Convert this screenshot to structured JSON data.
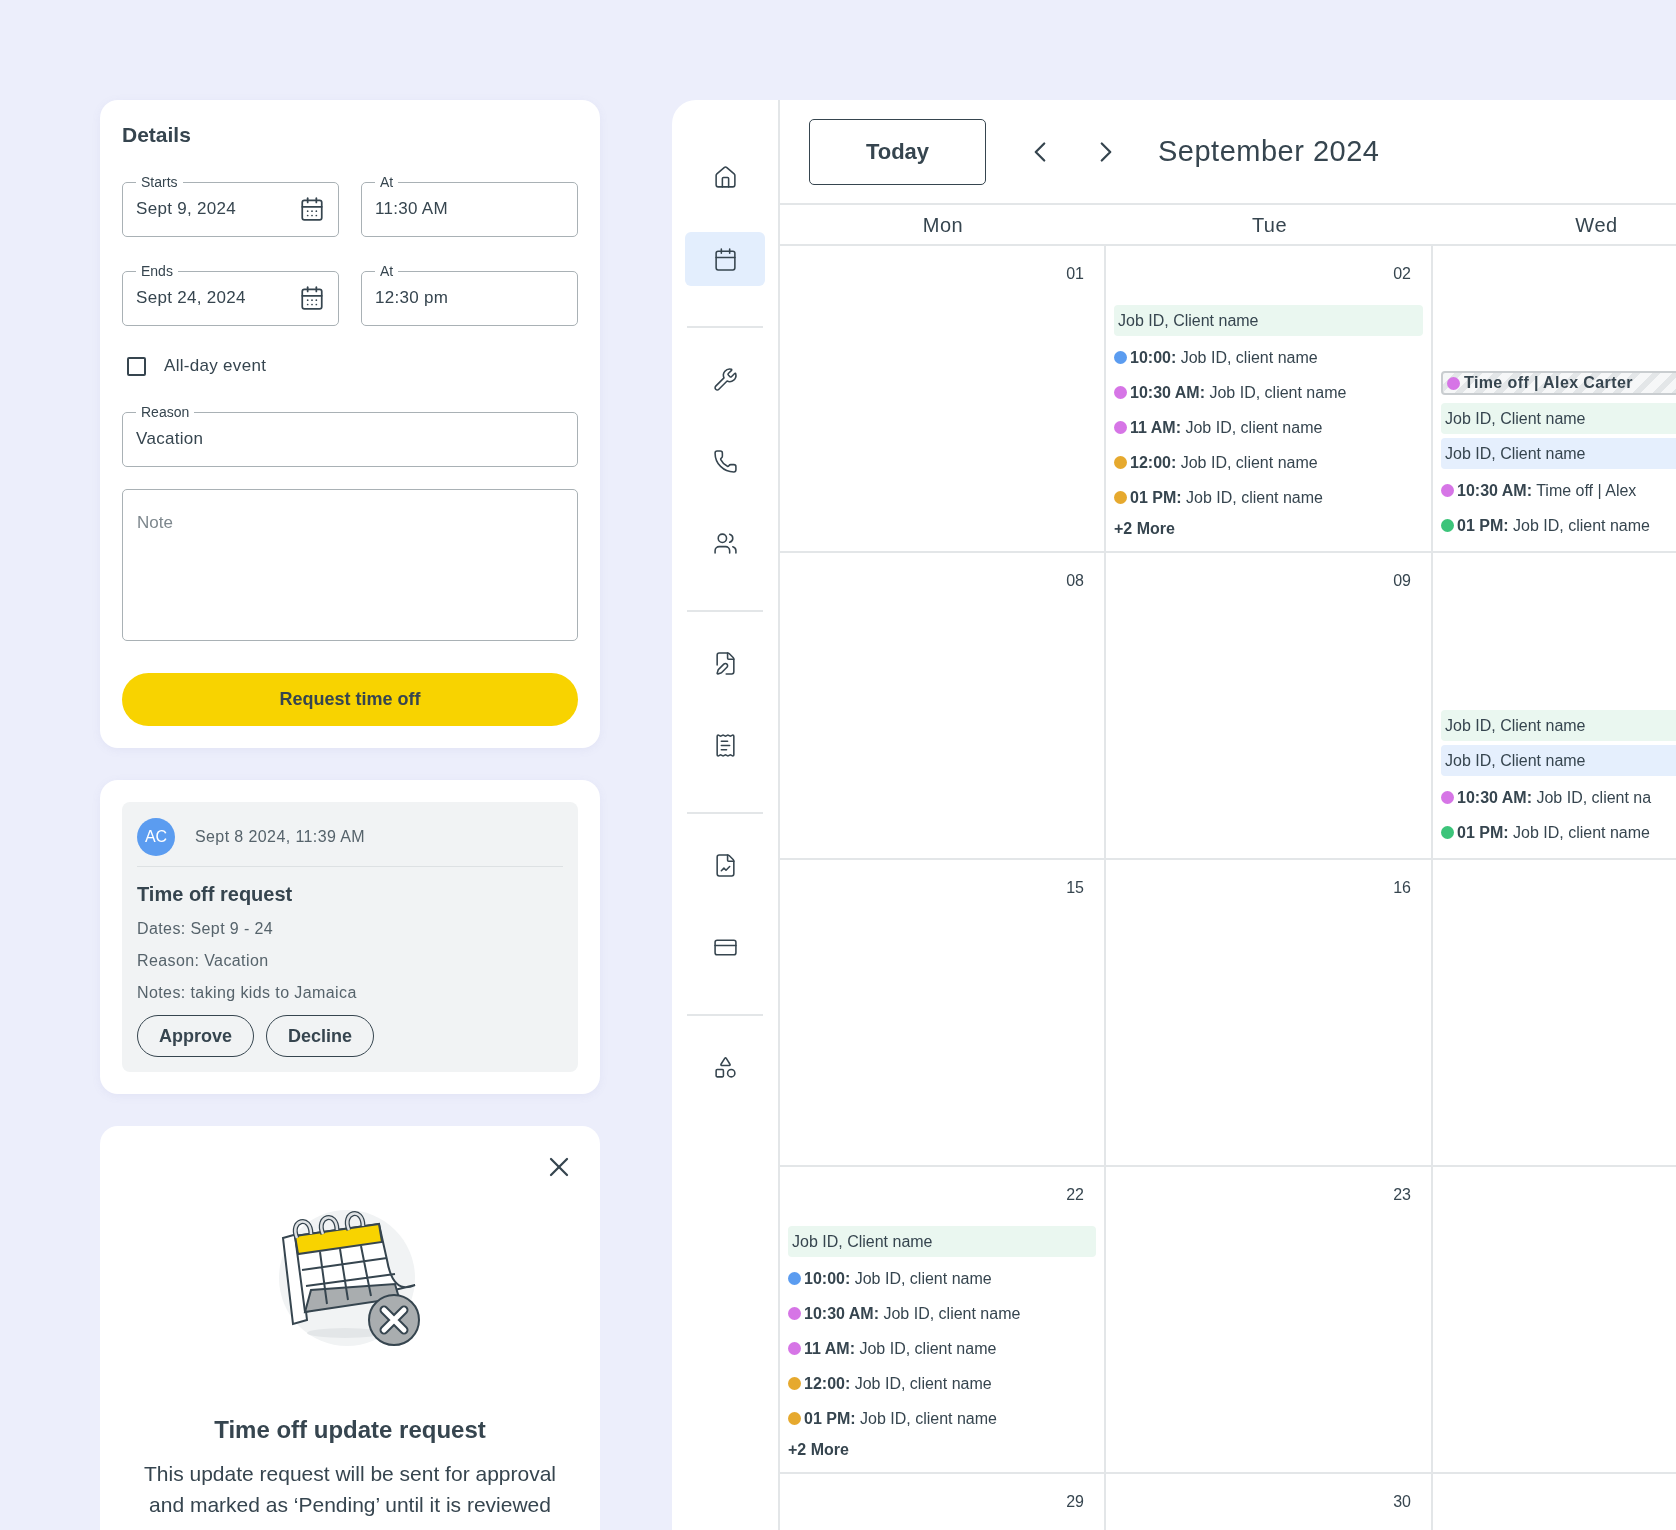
{
  "details": {
    "title": "Details",
    "fields": [
      {
        "label": "Starts",
        "value": "Sept 9, 2024",
        "kind": "date"
      },
      {
        "label": "At",
        "value": "11:30 AM",
        "kind": "time"
      },
      {
        "label": "Ends",
        "value": "Sept 24, 2024",
        "kind": "date"
      },
      {
        "label": "At",
        "value": "12:30 pm",
        "kind": "time"
      }
    ],
    "all_day": {
      "label": "All-day event",
      "checked": false
    },
    "reason": {
      "label": "Reason",
      "value": "Vacation"
    },
    "note": {
      "placeholder": "Note"
    },
    "submit": "Request time off"
  },
  "request_card": {
    "avatar": "AC",
    "timestamp": "Sept 8 2024, 11:39 AM",
    "title": "Time off request",
    "lines": [
      "Dates: Sept 9 - 24",
      "Reason: Vacation",
      "Notes: taking kids to Jamaica"
    ],
    "buttons": [
      "Approve",
      "Decline"
    ]
  },
  "dialog": {
    "title": "Time off update request",
    "message": "This update request will be sent for approval and marked as ‘Pending’ until it is reviewed"
  },
  "sidebar": {
    "groups": [
      {
        "items": [
          {
            "selected": false
          },
          {
            "selected": true
          }
        ]
      },
      {
        "items": [
          {
            "selected": false
          },
          {
            "selected": false
          },
          {
            "selected": false
          }
        ]
      },
      {
        "items": [
          {
            "selected": false
          },
          {
            "selected": false
          }
        ]
      },
      {
        "items": [
          {
            "selected": false
          },
          {
            "selected": false
          }
        ]
      },
      {
        "items": [
          {
            "selected": false
          }
        ]
      }
    ]
  },
  "calendar": {
    "today": "Today",
    "month": "September 2024",
    "days": [
      "Mon",
      "Tue",
      "Wed"
    ],
    "weeks": [
      {
        "cells": [
          {
            "date": "01"
          },
          {
            "date": "02",
            "events": [
              {
                "kind": "bar",
                "color": "#eaf7f0",
                "text": "Job ID, Client name"
              },
              {
                "kind": "timed",
                "color": "#5b9cf0",
                "time": "10:00:",
                "text": "Job ID, client name"
              },
              {
                "kind": "timed",
                "color": "#d675e6",
                "time": "10:30 AM:",
                "text": "Job ID, client name"
              },
              {
                "kind": "timed",
                "color": "#d675e6",
                "time": "11 AM:",
                "text": "Job ID, client name"
              },
              {
                "kind": "timed",
                "color": "#e6a92e",
                "time": "12:00:",
                "text": "Job ID, client name"
              },
              {
                "kind": "timed",
                "color": "#e6a92e",
                "time": "01 PM:",
                "text": "Job ID, client name"
              },
              {
                "kind": "more",
                "text": "+2 More"
              }
            ]
          },
          {
            "events": [
              {
                "kind": "timeoff",
                "color": "#d675e6",
                "text": "Time off | Alex Carter"
              },
              {
                "kind": "bar",
                "color": "#eaf7f0",
                "text": "Job ID, Client name"
              },
              {
                "kind": "bar",
                "color": "#e5effd",
                "text": "Job ID, Client name"
              },
              {
                "kind": "timed",
                "color": "#d675e6",
                "time": "10:30 AM:",
                "text": "Time off | Alex"
              },
              {
                "kind": "timed",
                "color": "#3cc47a",
                "time": "01 PM:",
                "text": "Job ID, client name"
              }
            ]
          }
        ]
      },
      {
        "cells": [
          {
            "date": "08"
          },
          {
            "date": "09"
          },
          {
            "events": [
              {
                "kind": "bar",
                "color": "#eaf7f0",
                "text": "Job ID, Client name"
              },
              {
                "kind": "bar",
                "color": "#e5effd",
                "text": "Job ID, Client name"
              },
              {
                "kind": "timed",
                "color": "#d675e6",
                "time": "10:30 AM:",
                "text": "Job ID, client na"
              },
              {
                "kind": "timed",
                "color": "#3cc47a",
                "time": "01 PM:",
                "text": "Job ID, client name"
              }
            ]
          }
        ]
      },
      {
        "cells": [
          {
            "date": "15"
          },
          {
            "date": "16"
          },
          {}
        ]
      },
      {
        "cells": [
          {
            "date": "22",
            "events": [
              {
                "kind": "bar",
                "color": "#eaf7f0",
                "text": "Job ID, Client name"
              },
              {
                "kind": "timed",
                "color": "#5b9cf0",
                "time": "10:00:",
                "text": "Job ID, client name"
              },
              {
                "kind": "timed",
                "color": "#d675e6",
                "time": "10:30 AM:",
                "text": "Job ID, client name"
              },
              {
                "kind": "timed",
                "color": "#d675e6",
                "time": "11 AM:",
                "text": "Job ID, client name"
              },
              {
                "kind": "timed",
                "color": "#e6a92e",
                "time": "12:00:",
                "text": "Job ID, client name"
              },
              {
                "kind": "timed",
                "color": "#e6a92e",
                "time": "01 PM:",
                "text": "Job ID, client name"
              },
              {
                "kind": "more",
                "text": "+2 More"
              }
            ]
          },
          {
            "date": "23"
          },
          {}
        ]
      },
      {
        "cells": [
          {
            "date": "29"
          },
          {
            "date": "30"
          },
          {}
        ]
      }
    ]
  }
}
